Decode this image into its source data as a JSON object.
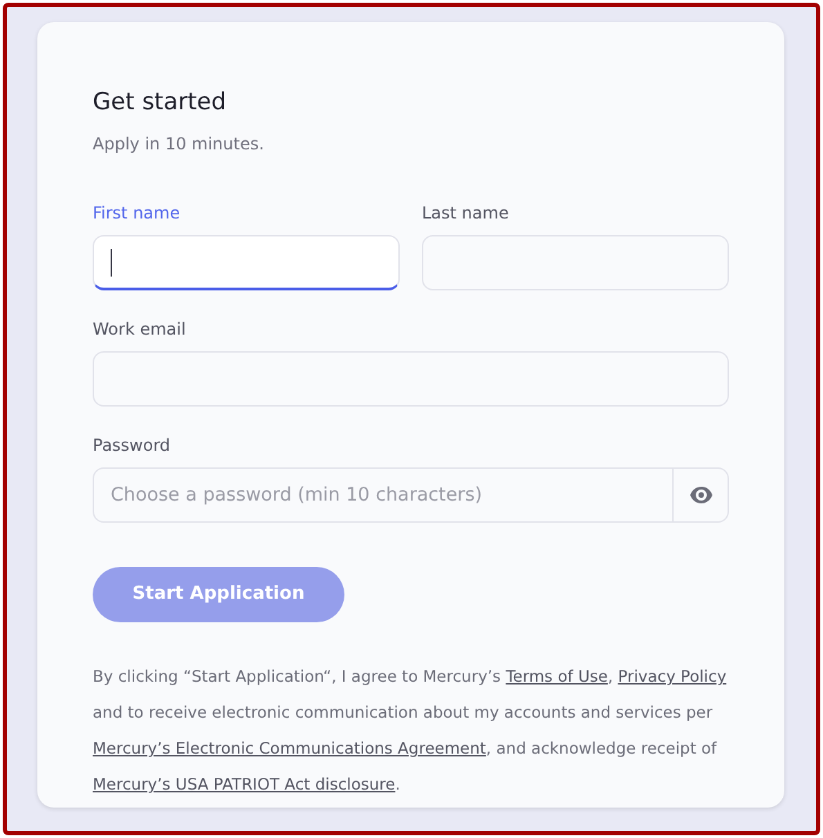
{
  "title": "Get started",
  "subtitle": "Apply in 10 minutes.",
  "field_rows": [
    [
      {
        "label": "First name",
        "focused": true
      },
      {
        "label": "Last name",
        "focused": false
      }
    ],
    [
      {
        "label": "Work email",
        "focused": false
      }
    ],
    [
      {
        "label": "Password",
        "focused": false,
        "placeholder": "Choose a password (min 10 characters)",
        "kind": "password"
      }
    ]
  ],
  "submit": {
    "label": "Start Application",
    "disabled": true
  },
  "legal": [
    {
      "kind": "text",
      "text": "By clicking “Start Application“, I agree to Mercury’s "
    },
    {
      "kind": "link",
      "text": "Terms of Use"
    },
    {
      "kind": "text",
      "text": ", "
    },
    {
      "kind": "link",
      "text": "Privacy Policy"
    },
    {
      "kind": "text",
      "text": " and to receive electronic communication about my accounts and services per "
    },
    {
      "kind": "link",
      "text": "Mercury’s Electronic Communications Agreement"
    },
    {
      "kind": "text",
      "text": ", and acknowledge receipt of "
    },
    {
      "kind": "link",
      "text": "Mercury’s USA PATRIOT Act disclosure"
    },
    {
      "kind": "text",
      "text": "."
    }
  ]
}
